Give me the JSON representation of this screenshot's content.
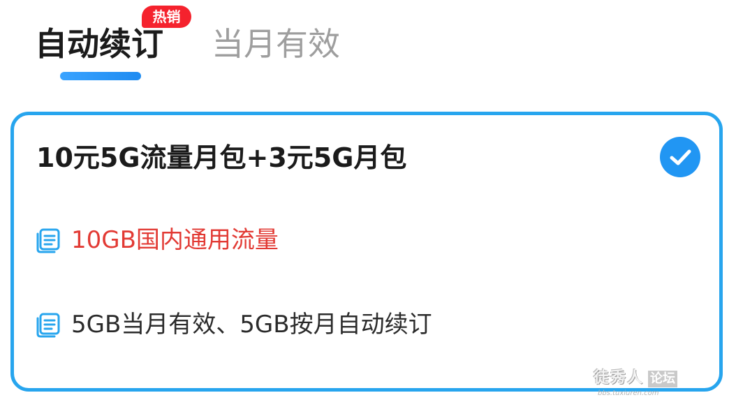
{
  "tabs": [
    {
      "label": "自动续订",
      "active": true,
      "badge": "热销"
    },
    {
      "label": "当月有效",
      "active": false
    }
  ],
  "plan": {
    "title": "10元5G流量月包+3元5G月包",
    "selected": true,
    "features": [
      {
        "text": "10GB国内通用流量",
        "highlight": true,
        "icon": "package-list-icon"
      },
      {
        "text": "5GB当月有效、5GB按月自动续订",
        "highlight": false,
        "icon": "package-list-icon"
      }
    ]
  },
  "watermark": {
    "main": "徒秀人",
    "box": "论坛",
    "sub": "bbs.tuxiuren.com"
  },
  "colors": {
    "accent": "#27a5ee",
    "check": "#2196f3",
    "badge": "#f5222d",
    "highlight_text": "#e23a34",
    "inactive_tab": "#9e9e9e"
  }
}
